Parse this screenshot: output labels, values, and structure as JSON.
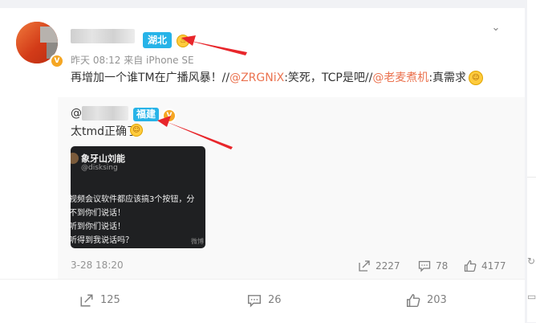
{
  "post": {
    "author_location": "湖北",
    "meta": "昨天 08:12  来自 iPhone SE",
    "text_prefix": "再增加一个谁TM在广播风暴！//",
    "mention1": "@ZRGNiX",
    "text_mid": ":笑死，TCP是吧//",
    "mention2": "@老麦煮机",
    "text_suffix": ":真需求"
  },
  "repost": {
    "at": "@",
    "location": "福建",
    "text": "太tmd正确了",
    "image": {
      "name": "象牙山刘能",
      "handle": "@disksing",
      "lines": [
        "视频会议软件都应该搞3个按钮，分",
        "不到你们说话！",
        "听到你们说话！",
        "听得到我说话吗？"
      ],
      "watermark": "微博"
    },
    "time": "3-28 18:20",
    "share_count": "2227",
    "comment_count": "78",
    "like_count": "4177"
  },
  "footer": {
    "share_count": "125",
    "comment_count": "26",
    "like_count": "203"
  },
  "colors": {
    "accent_link": "#eb7350",
    "location_badge": "#27b3e8",
    "arrow": "#e8262b"
  }
}
